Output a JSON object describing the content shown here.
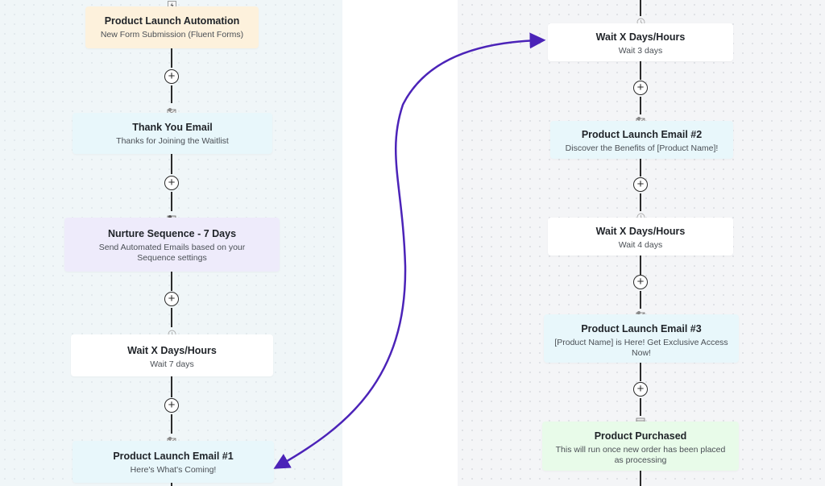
{
  "colors": {
    "arrow": "#4b23b8",
    "trigger_bg": "#fdf1dc",
    "email_bg": "#e8f7fb",
    "sequence_bg": "#eeebfb",
    "wait_bg": "#ffffff",
    "purchase_bg": "#e8fbe9"
  },
  "left_flow": {
    "nodes": [
      {
        "type": "trigger",
        "icon": "lightning-icon",
        "title": "Product Launch Automation",
        "subtitle": "New Form Submission (Fluent Forms)"
      },
      {
        "type": "email",
        "icon": "email-icon",
        "title": "Thank You Email",
        "subtitle": "Thanks for Joining the Waitlist"
      },
      {
        "type": "sequence",
        "icon": "sequence-icon",
        "title": "Nurture Sequence - 7 Days",
        "subtitle": "Send Automated Emails based on your Sequence settings"
      },
      {
        "type": "wait",
        "icon": "clock-icon",
        "title": "Wait X Days/Hours",
        "subtitle": "Wait 7 days"
      },
      {
        "type": "email",
        "icon": "email-icon",
        "title": "Product Launch Email #1",
        "subtitle": "Here's What's Coming!"
      }
    ]
  },
  "right_flow": {
    "nodes": [
      {
        "type": "wait",
        "icon": "clock-icon",
        "title": "Wait X Days/Hours",
        "subtitle": "Wait 3 days"
      },
      {
        "type": "email",
        "icon": "email-icon",
        "title": "Product Launch Email #2",
        "subtitle": "Discover the Benefits of [Product Name]!"
      },
      {
        "type": "wait",
        "icon": "clock-icon",
        "title": "Wait X Days/Hours",
        "subtitle": "Wait 4 days"
      },
      {
        "type": "email",
        "icon": "email-icon",
        "title": "Product Launch Email #3",
        "subtitle": "[Product Name] is Here! Get Exclusive Access Now!"
      },
      {
        "type": "purchase",
        "icon": "cart-check-icon",
        "title": "Product Purchased",
        "subtitle": "This will run once new order has been placed as processing"
      }
    ]
  },
  "add_step_symbol": "+",
  "connector": {
    "from": "left_flow.nodes.4",
    "to": "right_flow.nodes.0",
    "style": "curved-double-arrow"
  }
}
